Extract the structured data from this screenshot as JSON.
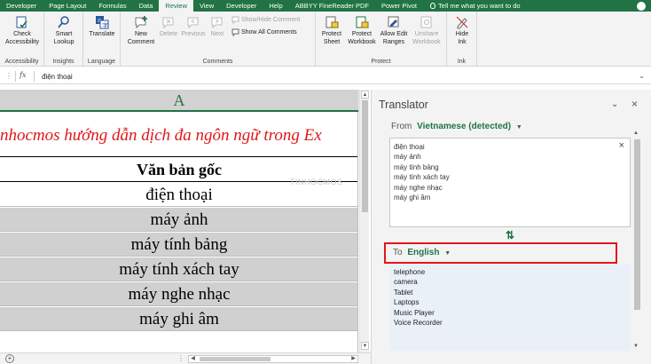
{
  "ribbon_tabs": [
    {
      "label": "Developer",
      "active": false
    },
    {
      "label": "Page Layout",
      "active": false
    },
    {
      "label": "Formulas",
      "active": false
    },
    {
      "label": "Data",
      "active": false
    },
    {
      "label": "Review",
      "active": true
    },
    {
      "label": "View",
      "active": false
    },
    {
      "label": "Developer",
      "active": false
    },
    {
      "label": "Help",
      "active": false
    },
    {
      "label": "ABBYY FineReader PDF",
      "active": false
    },
    {
      "label": "Power Pivot",
      "active": false
    }
  ],
  "tell_me": "Tell me what you want to do",
  "ribbon": {
    "accessibility": {
      "button": "Check\nAccessibility",
      "group": "Accessibility"
    },
    "insights": {
      "button": "Smart\nLookup",
      "group": "Insights"
    },
    "language": {
      "button": "Translate",
      "group": "Language"
    },
    "comments": {
      "new_comment": "New\nComment",
      "delete": "Delete",
      "previous": "Previous",
      "next": "Next",
      "show_hide": "Show/Hide Comment",
      "show_all": "Show All Comments",
      "group": "Comments"
    },
    "protect": {
      "protect_sheet": "Protect\nSheet",
      "protect_workbook": "Protect\nWorkbook",
      "allow_edit": "Allow Edit\nRanges",
      "unshare": "Unshare\nWorkbook",
      "group": "Protect"
    },
    "ink": {
      "button": "Hide\nInk",
      "group": "Ink"
    }
  },
  "formula_bar": {
    "fx": "fx",
    "value": "điện thoại"
  },
  "sheet": {
    "column_header": "A",
    "title": "nhocmos hướng dẫn dịch đa ngôn ngữ trong Ex",
    "header": "Văn bản gốc",
    "rows": [
      {
        "text": "điện thoại",
        "shaded": false
      },
      {
        "text": "máy ảnh",
        "shaded": true
      },
      {
        "text": "máy tính bảng",
        "shaded": true
      },
      {
        "text": "máy tính xách tay",
        "shaded": true
      },
      {
        "text": "máy nghe nhạc",
        "shaded": true
      },
      {
        "text": "máy ghi âm",
        "shaded": true
      }
    ]
  },
  "translator": {
    "title": "Translator",
    "from_label": "From",
    "from_lang": "Vietnamese (detected)",
    "source_text": "điện thoại\nmáy ảnh\nmáy tính bảng\nmáy tính xách tay\nmáy nghe nhạc\nmáy ghi âm",
    "to_label": "To",
    "to_lang": "English",
    "translated_text": "telephone\ncamera\nTablet\nLaptops\nMusic Player\nVoice Recorder"
  },
  "watermark": "TINHOCMOS",
  "colors": {
    "excel_green": "#217346",
    "title_red": "#e0171b",
    "highlight_box": "#e0171b",
    "translated_bg": "#eaf0f8"
  }
}
